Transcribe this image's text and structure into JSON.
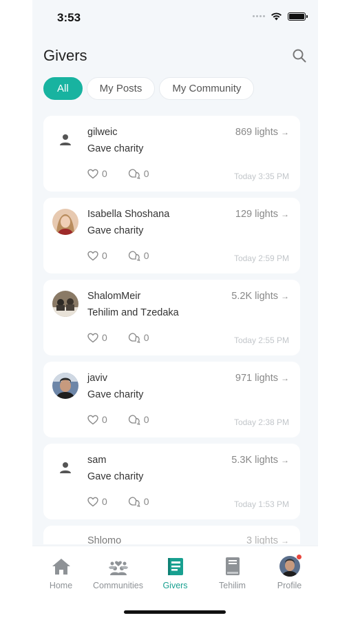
{
  "status": {
    "time": "3:53"
  },
  "header": {
    "title": "Givers"
  },
  "filters": [
    {
      "label": "All",
      "active": true
    },
    {
      "label": "My Posts",
      "active": false
    },
    {
      "label": "My Community",
      "active": false
    }
  ],
  "posts": [
    {
      "name": "gilweic",
      "action": "Gave charity",
      "lights": "869 lights",
      "likes": "0",
      "comments": "0",
      "time": "Today 3:35 PM",
      "avatar": "placeholder"
    },
    {
      "name": "Isabella Shoshana",
      "action": "Gave charity",
      "lights": "129 lights",
      "likes": "0",
      "comments": "0",
      "time": "Today 2:59 PM",
      "avatar": "photo"
    },
    {
      "name": "ShalomMeir",
      "action": "Tehilim and Tzedaka",
      "lights": "5.2K lights",
      "likes": "0",
      "comments": "0",
      "time": "Today 2:55 PM",
      "avatar": "photo"
    },
    {
      "name": "javiv",
      "action": "Gave charity",
      "lights": "971 lights",
      "likes": "0",
      "comments": "0",
      "time": "Today 2:38 PM",
      "avatar": "photo"
    },
    {
      "name": "sam",
      "action": "Gave charity",
      "lights": "5.3K lights",
      "likes": "0",
      "comments": "0",
      "time": "Today 1:53 PM",
      "avatar": "placeholder"
    },
    {
      "name": "Shlomo",
      "lights": "3 lights"
    }
  ],
  "tabs": [
    {
      "label": "Home",
      "icon": "home-icon"
    },
    {
      "label": "Communities",
      "icon": "communities-icon"
    },
    {
      "label": "Givers",
      "icon": "givers-icon",
      "active": true
    },
    {
      "label": "Tehilim",
      "icon": "book-icon"
    },
    {
      "label": "Profile",
      "icon": "profile-avatar"
    }
  ],
  "colors": {
    "accent": "#18b3a0",
    "background": "#f4f7fa",
    "notification": "#e8453c"
  }
}
